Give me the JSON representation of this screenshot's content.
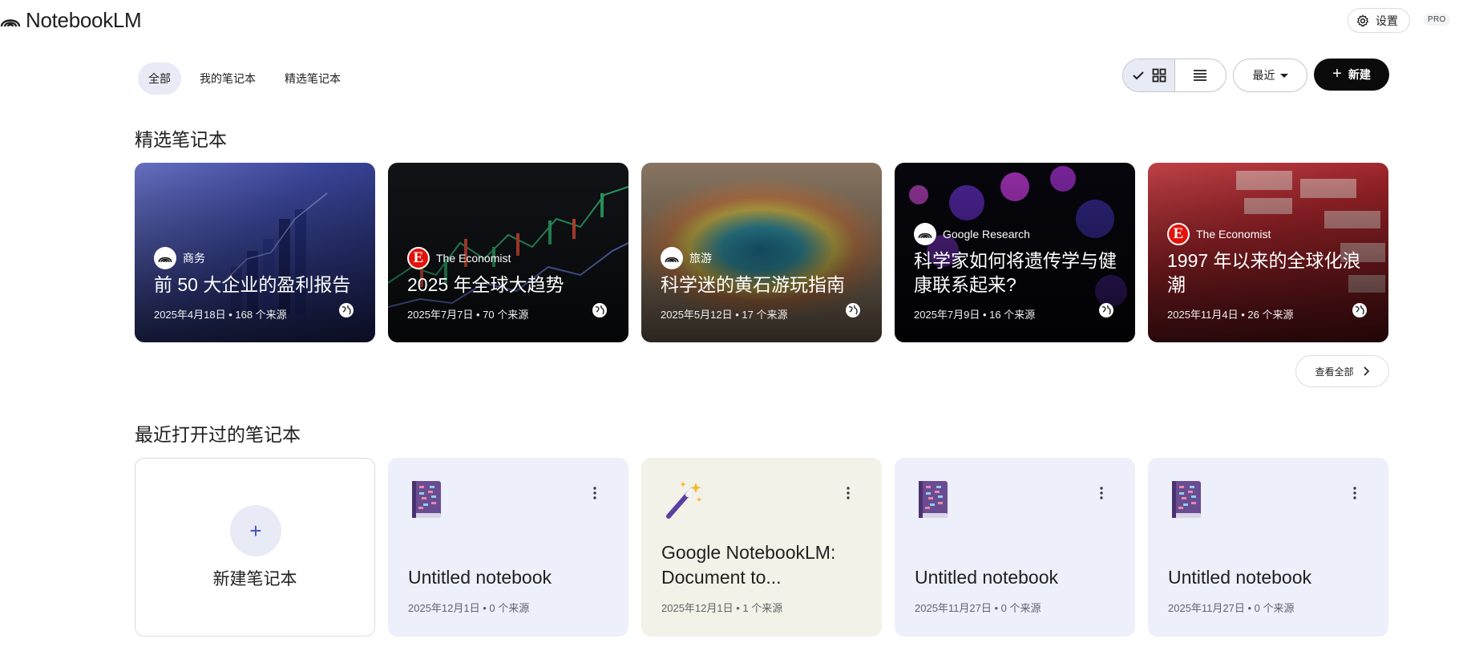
{
  "header": {
    "brand": "NotebookLM",
    "settings_label": "设置",
    "settings_icon": "gear-icon",
    "tier_badge": "PRO"
  },
  "tabs": [
    {
      "label": "全部",
      "active": true
    },
    {
      "label": "我的笔记本",
      "active": false
    },
    {
      "label": "精选笔记本",
      "active": false
    }
  ],
  "toolbar": {
    "view_grid_icon": "grid-view-icon",
    "view_list_icon": "list-view-icon",
    "sort_label": "最近",
    "new_label": "新建"
  },
  "featured": {
    "title": "精选笔记本",
    "view_all_label": "查看全部",
    "cards": [
      {
        "source": "商务",
        "title": "前 50 大企业的盈利报告",
        "meta": "2025年4月18日 • 168 个来源",
        "logo": "notebooklm",
        "accent": "#4a55a2"
      },
      {
        "source": "The Economist",
        "title": "2025 年全球大趋势",
        "meta": "2025年7月7日 • 70 个来源",
        "logo": "economist",
        "accent": "#1a1a1a"
      },
      {
        "source": "旅游",
        "title": "科学迷的黄石游玩指南",
        "meta": "2025年5月12日 • 17 个来源",
        "logo": "notebooklm",
        "accent": "#3c8c9b"
      },
      {
        "source": "Google Research",
        "title": "科学家如何将遗传学与健康联系起来?",
        "meta": "2025年7月9日 • 16 个来源",
        "logo": "notebooklm",
        "accent": "#3a1460"
      },
      {
        "source": "The Economist",
        "title": "1997 年以来的全球化浪潮",
        "meta": "2025年11月4日 • 26 个来源",
        "logo": "economist",
        "accent": "#b8191e"
      }
    ]
  },
  "recent": {
    "title": "最近打开过的笔记本",
    "create_label": "新建笔记本",
    "cards": [
      {
        "title": "Untitled notebook",
        "meta": "2025年12月1日 • 0 个来源",
        "icon": "book-icon",
        "bg": "#edeffb"
      },
      {
        "title": "Google NotebookLM: Document to...",
        "meta": "2025年12月1日 • 1 个来源",
        "icon": "magic-wand-icon",
        "bg": "#f2f2e9"
      },
      {
        "title": "Untitled notebook",
        "meta": "2025年11月27日 • 0 个来源",
        "icon": "book-icon",
        "bg": "#edeffb"
      },
      {
        "title": "Untitled notebook",
        "meta": "2025年11月27日 • 0 个来源",
        "icon": "book-icon",
        "bg": "#edeffb"
      }
    ]
  }
}
